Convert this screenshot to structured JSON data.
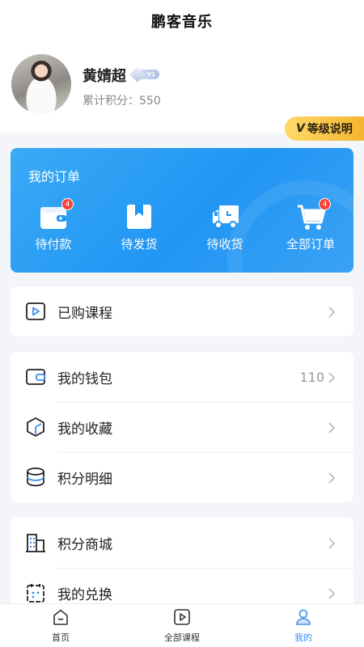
{
  "header": {
    "title": "鹏客音乐"
  },
  "profile": {
    "name": "黄婧超",
    "level_badge": "V1",
    "points_text": "累计积分：550",
    "level_button": {
      "v": "V",
      "label": "等级说明"
    }
  },
  "orders": {
    "title": "我的订单",
    "items": [
      {
        "label": "待付款",
        "badge": "4",
        "icon": "wallet-icon"
      },
      {
        "label": "待发货",
        "badge": "",
        "icon": "bookmark-box-icon"
      },
      {
        "label": "待收货",
        "badge": "",
        "icon": "truck-icon"
      },
      {
        "label": "全部订单",
        "badge": "4",
        "icon": "cart-icon"
      }
    ]
  },
  "menu": {
    "group1": [
      {
        "label": "已购课程",
        "icon": "play-course-icon"
      }
    ],
    "group2": [
      {
        "label": "我的钱包",
        "value": "110",
        "icon": "wallet-outline-icon"
      },
      {
        "label": "我的收藏",
        "icon": "cube-icon"
      },
      {
        "label": "积分明细",
        "icon": "coins-icon"
      }
    ],
    "group3": [
      {
        "label": "积分商城",
        "icon": "building-icon"
      },
      {
        "label": "我的兑换",
        "icon": "calendar-exchange-icon"
      }
    ]
  },
  "tabbar": [
    {
      "label": "首页",
      "icon": "home-icon"
    },
    {
      "label": "全部课程",
      "icon": "course-play-icon"
    },
    {
      "label": "我的",
      "icon": "user-icon",
      "active": true
    }
  ],
  "colors": {
    "accent": "#3a8ff0",
    "card_blue": "#2196f3",
    "badge_red": "#f44336",
    "gold": "#f4b62e"
  }
}
